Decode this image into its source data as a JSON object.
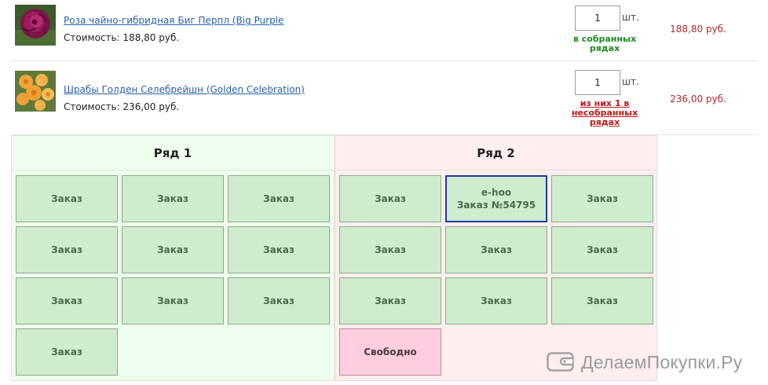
{
  "items": [
    {
      "name": "Роза чайно-гибридная Биг Перпл (Big Purple",
      "cost": "Стоимость: 188,80 руб.",
      "qty": "1",
      "unit": "шт.",
      "status": "в собранных рядах",
      "price": "188,80 руб."
    },
    {
      "name": "Шрабы Голден Селебрейшн (Golden Celebration)",
      "cost": "Стоимость: 236,00 руб.",
      "qty": "1",
      "unit": "шт.",
      "status": "из них 1 в несобранных рядах",
      "price": "236,00 руб."
    }
  ],
  "rows": [
    {
      "title": "Ряд 1",
      "cells": [
        {
          "label": "Заказ"
        },
        {
          "label": "Заказ"
        },
        {
          "label": "Заказ"
        },
        {
          "label": "Заказ"
        },
        {
          "label": "Заказ"
        },
        {
          "label": "Заказ"
        },
        {
          "label": "Заказ"
        },
        {
          "label": "Заказ"
        },
        {
          "label": "Заказ"
        },
        {
          "label": "Заказ"
        }
      ]
    },
    {
      "title": "Ряд 2",
      "cells": [
        {
          "label": "Заказ"
        },
        {
          "line1": "e-hoo",
          "line2": "Заказ №54795",
          "selected": true
        },
        {
          "label": "Заказ"
        },
        {
          "label": "Заказ"
        },
        {
          "label": "Заказ"
        },
        {
          "label": "Заказ"
        },
        {
          "label": "Заказ"
        },
        {
          "label": "Заказ"
        },
        {
          "label": "Заказ"
        },
        {
          "label": "Свободно",
          "free": true
        }
      ]
    }
  ],
  "watermark": "ДелаемПокупки.Ру",
  "colors": {
    "link": "#2a60a8",
    "price": "#b42a2a",
    "status_ok": "#1f8a1f",
    "status_bad": "#c01818",
    "cell_order": "#cfeccf",
    "cell_free": "#ffcce0",
    "row1_bg": "#efffee",
    "row2_bg": "#feeeee",
    "selected_border": "#1b3c9a"
  }
}
